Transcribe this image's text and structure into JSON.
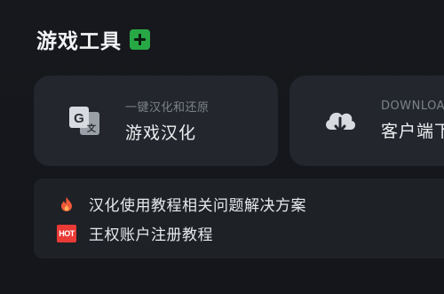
{
  "header": {
    "title": "游戏工具"
  },
  "cards": [
    {
      "sub": "一键汉化和还原",
      "main": "游戏汉化",
      "icon": "translate-icon"
    },
    {
      "sub": "DOWNLOAD",
      "main": "客户端下载",
      "icon": "cloud-download-icon"
    }
  ],
  "links": [
    {
      "text": "汉化使用教程相关问题解决方案",
      "icon": "fire-icon"
    },
    {
      "text": "王权账户注册教程",
      "icon": "hot-badge-icon",
      "badge": "HOT"
    }
  ],
  "colors": {
    "accent_green": "#27a845",
    "hot_red": "#e93a35",
    "fire_orange": "#f0593a"
  }
}
